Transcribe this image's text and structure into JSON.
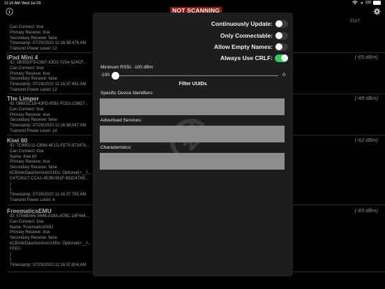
{
  "status_bar": {
    "time": "11:16 AM",
    "date": "Wed Jul 29",
    "battery": "100"
  },
  "header": {
    "scan_status": "NOT SCANNING",
    "edit_label": "EDIT"
  },
  "devices": [
    {
      "name": "",
      "lines": [
        "Can Connect: true",
        "Primary Receive: true",
        "Secondary Receive: false",
        "Timestamp: 07/29/2020 11:16:38.478 AM",
        "Transmit Power Level: 12"
      ],
      "rssi": ""
    },
    {
      "name": "iPad Mini 4",
      "lines": [
        "ID: 1B0592F9-C887-63D3-715A-524CF...",
        "Can Connect: true",
        "Primary Receive: true",
        "Secondary Receive: false",
        "Timestamp: 07/29/2020 11:16:37.961 AM",
        "Transmit Power Level: 12"
      ],
      "rssi": "(-65 dBm)"
    },
    {
      "name": "The Limper",
      "lines": [
        "ID: 086E5C1B-43FD-9551-FDD1-C9627...",
        "Can Connect: true",
        "Primary Receive: true",
        "Secondary Receive: false",
        "Timestamp: 07/29/2020 11:16:38.047 AM",
        "Transmit Power Level: 24"
      ],
      "rssi": "(-48 dBm)"
    },
    {
      "name": "Kiwi 60",
      "lines": [
        "ID: 7C990211-CB99-4E1D-FE75-973478...",
        "Can Connect: true",
        "Name: Kiwi 60",
        "Primary Receive: true",
        "Secondary Receive: false",
        "kCBAdvDataServiceUUIDs: Optional(<__f...",
        "E47C8027-CCA1-4E3B-981F-BDC47AB...",
        ")",
        ")",
        "Timestamp: 07/29/2020 11:16:37.785 AM",
        "Transmit Power Level: 4"
      ],
      "rssi": "(-62 dBm)"
    },
    {
      "name": "FreematicsEMU",
      "lines": [
        "ID: 5756BA65-5646-A19A-A05C-10F444...",
        "Can Connect: true",
        "Name: FreematicsEMU",
        "Primary Receive: true",
        "Secondary Receive: false",
        "kCBAdvDataServiceUUIDs: Optional(<__f...",
        "FFE0",
        ")",
        ")",
        "Timestamp: 07/29/2020 11:16:37.804 AM"
      ],
      "rssi": "(-83 dBm)"
    }
  ],
  "settings": {
    "toggles": [
      {
        "label": "Continuously Update:",
        "on": false
      },
      {
        "label": "Only Connectable:",
        "on": false
      },
      {
        "label": "Allow Empty Names:",
        "on": false
      },
      {
        "label": "Always Use CRLF:",
        "on": true
      }
    ],
    "rssi_label": "Minimum RSSI: -100 dBm",
    "slider": {
      "min_label": "-100",
      "max_label": "0",
      "value": -100,
      "min": -100,
      "max": 0
    },
    "filter_title": "Filter UUIDs",
    "fields": [
      {
        "label": "Specific Device Identifiers:",
        "value": ""
      },
      {
        "label": "Advertised Services:",
        "value": ""
      },
      {
        "label": "Characteristics:",
        "value": ""
      }
    ]
  },
  "colors": {
    "scan_badge": "#8a1a12",
    "switch_on": "#34c759",
    "switch_off": "#3a3a3c",
    "field_bg": "#8c8c8c"
  }
}
